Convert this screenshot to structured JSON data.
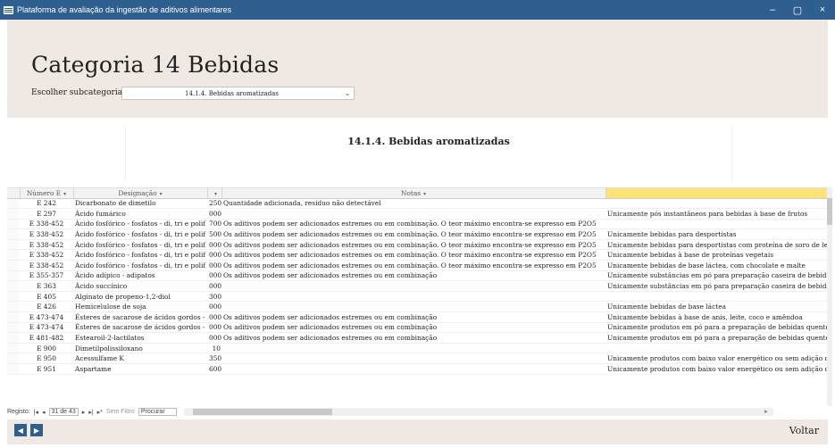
{
  "window": {
    "title": "Plataforma de avaliação da ingestão de aditivos alimentares",
    "minimize": "–",
    "restore": "▢",
    "close": "×"
  },
  "header": {
    "title": "Categoria 14 Bebidas",
    "subcategory_label": "Escolher subcategoria",
    "subcategory_value": "14.1.4. Bebidas aromatizadas"
  },
  "section": {
    "title": "14.1.4. Bebidas aromatizadas"
  },
  "grid": {
    "columns": [
      "Número E",
      "Designação",
      "",
      "Notas",
      ""
    ],
    "rows": [
      [
        "E 242",
        "Dicarbonato de dimetilo",
        "250",
        "Quantidade adicionada, resíduo não detectável",
        ""
      ],
      [
        "E 297",
        "Ácido fumárico",
        "000",
        "",
        "Unicamente pós instantâneos para bebidas à base de frutos"
      ],
      [
        "E 338-452",
        "Ácido fosfórico - fosfatos - di, tri e polif",
        "700",
        "Os aditivos podem ser adicionados estremes ou em combinação. O teor máximo encontra-se expresso em P2O5",
        ""
      ],
      [
        "E 338-452",
        "Ácido fosfórico - fosfatos - di, tri e polif",
        "500",
        "Os aditivos podem ser adicionados estremes ou em combinação. O teor máximo encontra-se expresso em P2O5",
        "Unicamente bebidas para desportistas"
      ],
      [
        "E 338-452",
        "Ácido fosfórico - fosfatos - di, tri e polif",
        "000",
        "Os aditivos podem ser adicionados estremes ou em combinação. O teor máximo encontra-se expresso em P2O5",
        "Unicamente bebidas para desportistas com proteína de soro de leite"
      ],
      [
        "E 338-452",
        "Ácido fosfórico - fosfatos - di, tri e polif",
        "000",
        "Os aditivos podem ser adicionados estremes ou em combinação. O teor máximo encontra-se expresso em P2O5",
        "Unicamente bebidas à base de proteínas vegetais"
      ],
      [
        "E 338-452",
        "Ácido fosfórico - fosfatos - di, tri e polif",
        "000",
        "Os aditivos podem ser adicionados estremes ou em combinação. O teor máximo encontra-se expresso em P2O5",
        "Unicamente bebidas de base láctea, com chocolate e malte"
      ],
      [
        "E 355-357",
        "Ácido adípico - adipatos",
        "000",
        "Os aditivos podem ser adicionados estremes ou em combinação",
        "Unicamente substâncias em pó para preparação caseira de bebidas"
      ],
      [
        "E 363",
        "Ácido succínico",
        "000",
        "",
        "Unicamente substâncias em pó para preparação caseira de bebidas"
      ],
      [
        "E 405",
        "Alginato de propeno-1,2-diol",
        "300",
        "",
        ""
      ],
      [
        "E 426",
        "Hemicelulose de soja",
        "000",
        "",
        "Unicamente bebidas de base láctea"
      ],
      [
        "E 473-474",
        "Ésteres de sacarose de ácidos gordos -",
        "000",
        "Os aditivos podem ser adicionados estremes ou em combinação",
        "Unicamente bebidas à base de anis, leite, coco e amêndoa"
      ],
      [
        "E 473-474",
        "Ésteres de sacarose de ácidos gordos -",
        "000",
        "Os aditivos podem ser adicionados estremes ou em combinação",
        "Unicamente produtos em pó para a preparação de bebidas quentes"
      ],
      [
        "E 481-482",
        "Estearoil-2-lactilatos",
        "000",
        "Os aditivos podem ser adicionados estremes ou em combinação",
        "Unicamente produtos em pó para a preparação de bebidas quentes"
      ],
      [
        "E 900",
        "Dimetilpolissiloxano",
        "10",
        "",
        ""
      ],
      [
        "E 950",
        "Acessulfame K",
        "350",
        "",
        "Unicamente produtos com baixo valor energético ou sem adição de"
      ],
      [
        "E 951",
        "Aspartame",
        "600",
        "",
        "Unicamente produtos com baixo valor energético ou sem adição de"
      ]
    ]
  },
  "recnav": {
    "label": "Registo:",
    "first": "|◂",
    "prev": "◂",
    "position": "31 de 43",
    "next": "▸",
    "last": "▸|",
    "new": "▸*",
    "filter": "Sem Filtro",
    "search": "Procurar"
  },
  "footer": {
    "prev": "◀",
    "next": "▶",
    "voltar": "Voltar"
  },
  "colors": {
    "titlebar": "#2e5f8f",
    "header_bg": "#efe8e3",
    "highlight_header": "#ffe475"
  }
}
